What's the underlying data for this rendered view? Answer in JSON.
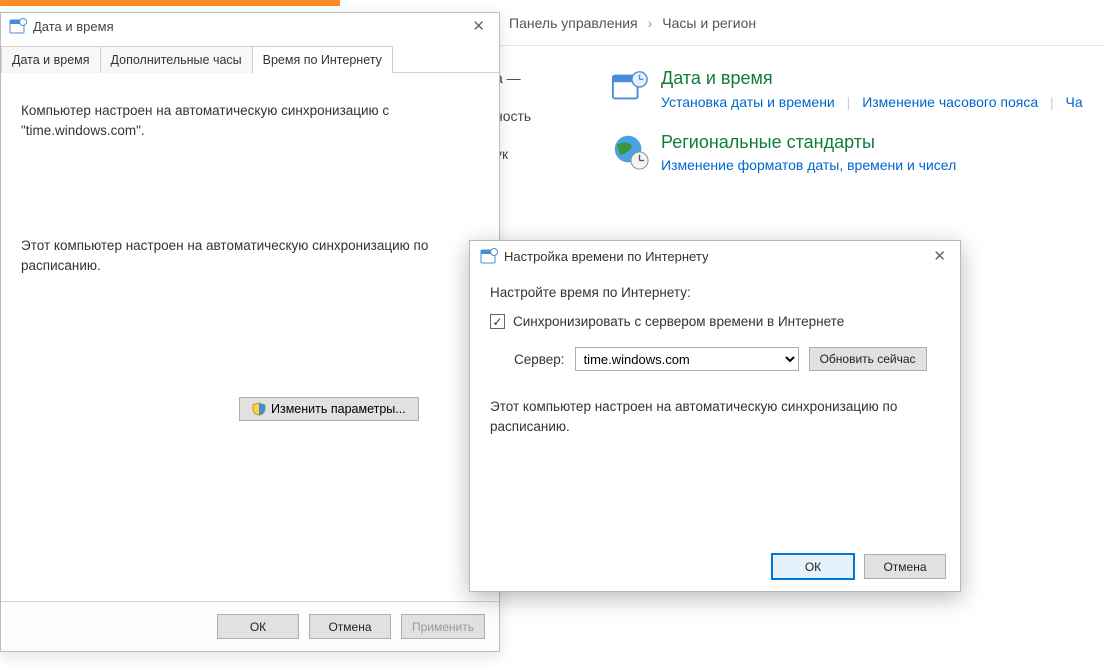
{
  "breadcrumb": {
    "panel": "Панель управления",
    "section": "Часы и регион"
  },
  "cp_side": {
    "item1": "а —",
    "item2": "ность",
    "item3": "ук"
  },
  "cp_date": {
    "title": "Дата и время",
    "link1": "Установка даты и времени",
    "link2": "Изменение часового пояса",
    "link3": "Ча"
  },
  "cp_region": {
    "title": "Региональные стандарты",
    "link1": "Изменение форматов даты, времени и чисел"
  },
  "dlg_dt": {
    "title": "Дата и время",
    "tab1": "Дата и время",
    "tab2": "Дополнительные часы",
    "tab3": "Время по Интернету",
    "info": "Компьютер настроен на автоматическую синхронизацию с \"time.windows.com\".",
    "sched": "Этот компьютер настроен на автоматическую синхронизацию по расписанию.",
    "change": "Изменить параметры...",
    "ok": "ОК",
    "cancel": "Отмена",
    "apply": "Применить"
  },
  "dlg_its": {
    "title": "Настройка времени по Интернету",
    "prompt": "Настройте время по Интернету:",
    "sync": "Синхронизировать с сервером времени в Интернете",
    "server_label": "Сервер:",
    "server": "time.windows.com",
    "update": "Обновить сейчас",
    "sched": "Этот компьютер настроен на автоматическую синхронизацию по расписанию.",
    "ok": "ОК",
    "cancel": "Отмена"
  }
}
